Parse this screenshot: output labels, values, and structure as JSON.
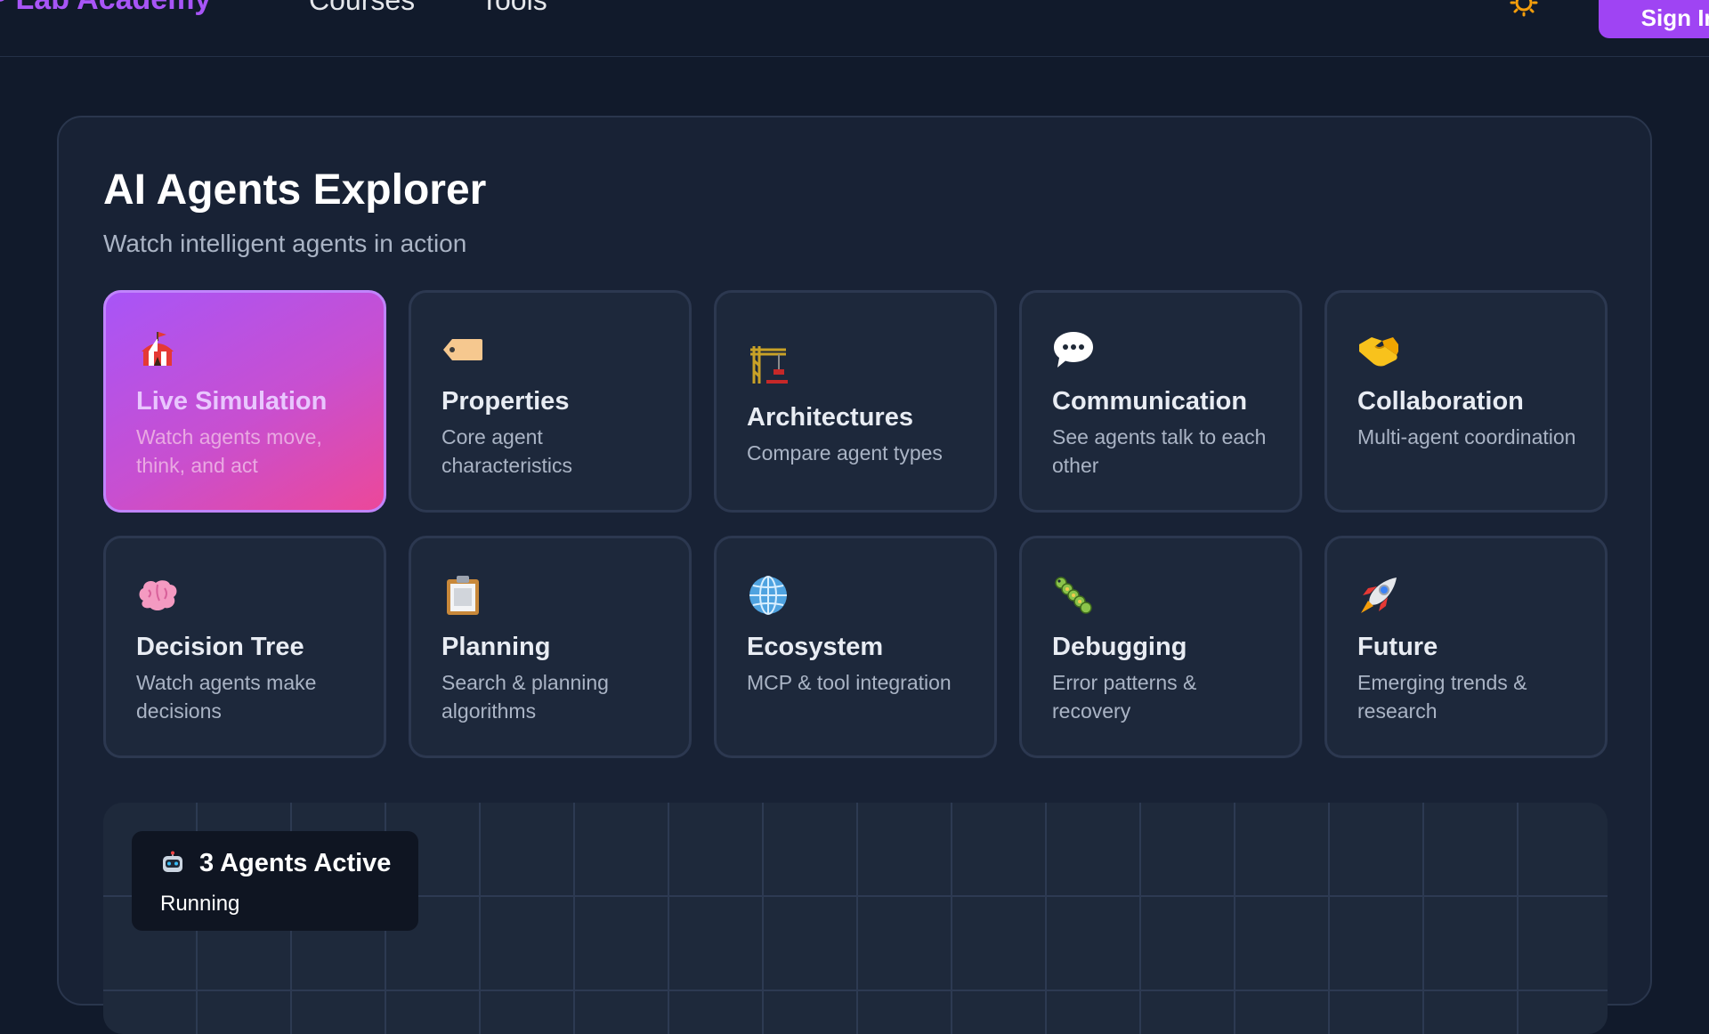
{
  "nav": {
    "brand": "P Lab Academy",
    "links": [
      "Courses",
      "Tools"
    ],
    "theme_icon": "sun-icon",
    "sign_in_label": "Sign In"
  },
  "explorer": {
    "title": "AI Agents Explorer",
    "subtitle": "Watch intelligent agents in action",
    "cards": [
      {
        "title": "Live Simulation",
        "description": "Watch agents move, think, and act",
        "icon": "circus-tent-icon",
        "active": true
      },
      {
        "title": "Properties",
        "description": "Core agent characteristics",
        "icon": "tag-icon"
      },
      {
        "title": "Architectures",
        "description": "Compare agent types",
        "icon": "crane-icon"
      },
      {
        "title": "Communication",
        "description": "See agents talk to each other",
        "icon": "speech-bubble-icon"
      },
      {
        "title": "Collaboration",
        "description": "Multi-agent coordination",
        "icon": "handshake-icon"
      },
      {
        "title": "Decision Tree",
        "description": "Watch agents make decisions",
        "icon": "brain-icon"
      },
      {
        "title": "Planning",
        "description": "Search & planning algorithms",
        "icon": "clipboard-icon"
      },
      {
        "title": "Ecosystem",
        "description": "MCP & tool integration",
        "icon": "globe-icon"
      },
      {
        "title": "Debugging",
        "description": "Error patterns & recovery",
        "icon": "bug-icon"
      },
      {
        "title": "Future",
        "description": "Emerging trends & research",
        "icon": "rocket-icon"
      }
    ]
  },
  "simulation": {
    "status_title": "3 Agents Active",
    "status_subtitle": "Running",
    "status_icon": "robot-icon"
  },
  "colors": {
    "accent": "#a855f7",
    "active_gradient_start": "#a855f7",
    "active_gradient_end": "#ec4899",
    "background": "#111a2b"
  }
}
